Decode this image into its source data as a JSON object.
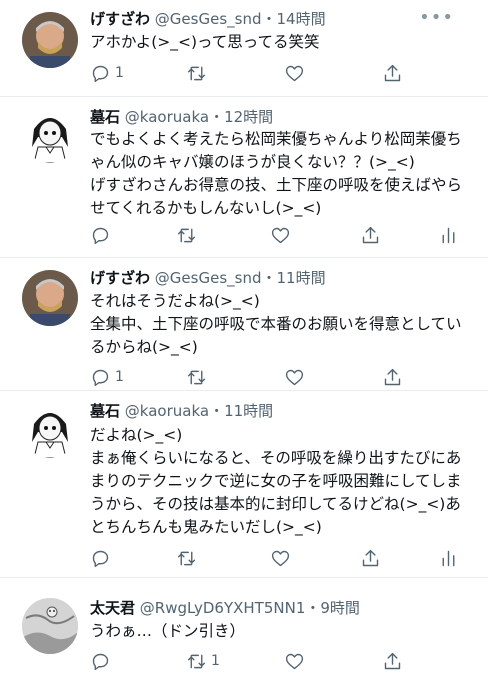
{
  "tweets": [
    {
      "name": "げすざわ",
      "handle": "@GesGes_snd",
      "time": "14時間",
      "text": "アホかよ(>_<)って思ってる笑笑",
      "reply_count": "1",
      "retweet_count": "",
      "show_analytics": false
    },
    {
      "name": "墓石",
      "handle": "@kaoruaka",
      "time": "12時間",
      "text": "でもよくよく考えたら松岡茉優ちゃんより松岡茉優ちゃん似のキャバ嬢のほうが良くない？？(>_<)\nげすざわさんお得意の技、土下座の呼吸を使えばやらせてくれるかもしんないし(>_<)",
      "reply_count": "",
      "retweet_count": "",
      "show_analytics": true
    },
    {
      "name": "げすざわ",
      "handle": "@GesGes_snd",
      "time": "11時間",
      "text": "それはそうだよね(>_<)\n全集中、土下座の呼吸で本番のお願いを得意としているからね(>_<)",
      "reply_count": "1",
      "retweet_count": "",
      "show_analytics": false
    },
    {
      "name": "墓石",
      "handle": "@kaoruaka",
      "time": "11時間",
      "text": "だよね(>_<)\nまぁ俺くらいになると、その呼吸を繰り出すたびにあまりのテクニックで逆に女の子を呼吸困難にしてしまうから、その技は基本的に封印してるけどね(>_<)あとちんちんも鬼みたいだし(>_<)",
      "reply_count": "",
      "retweet_count": "",
      "show_analytics": true
    },
    {
      "name": "太天君",
      "handle": "@RwgLyD6YXHT5NN1",
      "time": "9時間",
      "text": "うわぁ…（ドン引き）",
      "reply_count": "",
      "retweet_count": "1",
      "show_analytics": false
    }
  ],
  "separator": "・",
  "icons": {
    "more": "more-dots-icon",
    "reply": "reply-icon",
    "retweet": "retweet-icon",
    "like": "like-icon",
    "share": "share-icon",
    "analytics": "analytics-icon"
  },
  "colors": {
    "text": "#0f1419",
    "secondary": "#536471",
    "divider": "#e6ecf0"
  }
}
